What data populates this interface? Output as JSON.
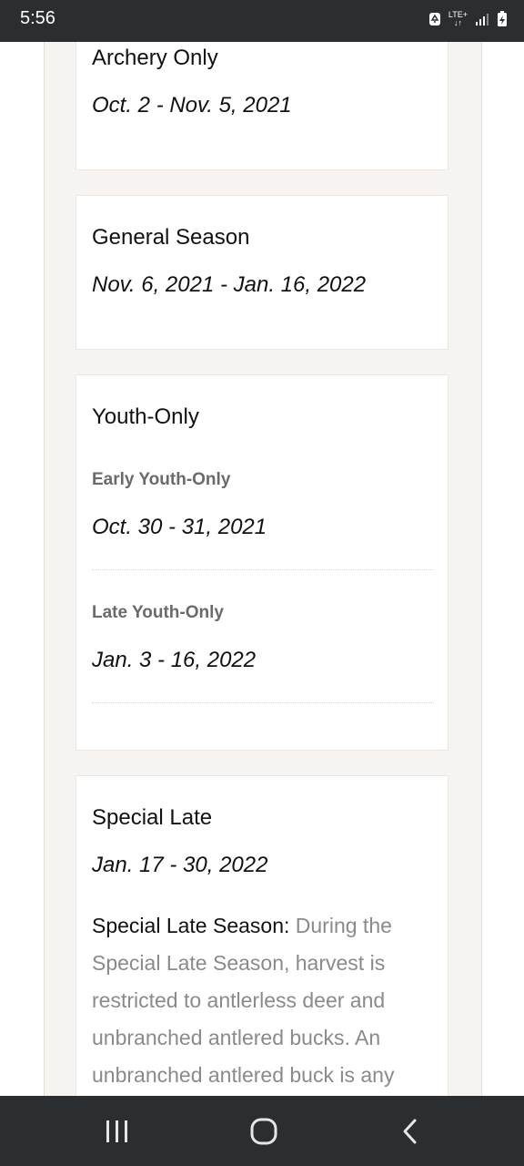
{
  "status": {
    "time": "5:56",
    "network": "LTE+"
  },
  "seasons": [
    {
      "title": "Archery Only",
      "date": "Oct. 2 - Nov. 5, 2021"
    },
    {
      "title": "General Season",
      "date": "Nov. 6, 2021 - Jan. 16, 2022"
    }
  ],
  "youth": {
    "title": "Youth-Only",
    "items": [
      {
        "label": "Early Youth-Only",
        "date": "Oct. 30 - 31, 2021"
      },
      {
        "label": "Late Youth-Only",
        "date": "Jan. 3 - 16, 2022"
      }
    ]
  },
  "special": {
    "title": "Special Late",
    "date": "Jan. 17 - 30, 2022",
    "lead": "Special Late Season:",
    "lines": [
      " During the",
      "Special Late Season, harvest is",
      "restricted to antlerless deer and",
      "unbranched antlered bucks. An",
      "unbranched antlered buck is any"
    ]
  },
  "nav": {
    "recents": "recents-icon",
    "home": "home-icon",
    "back": "back-icon"
  }
}
